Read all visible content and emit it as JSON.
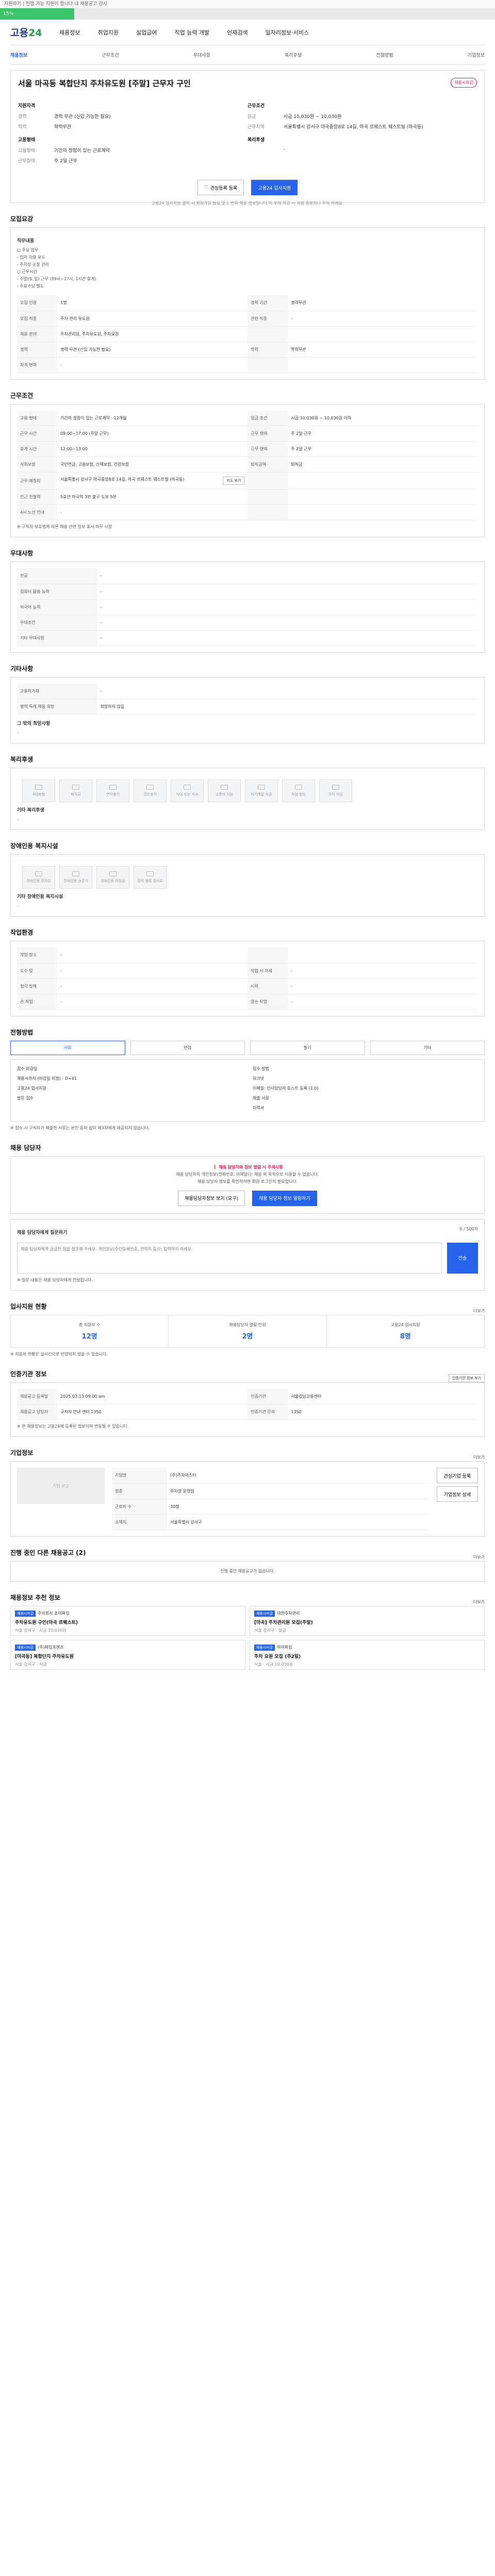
{
  "notice": "지원하기 | 진행 가능 지원이 합니다 내 채용공고 검사",
  "progress": {
    "label": "15%",
    "fraction": 0.15
  },
  "logo": {
    "a": "고용",
    "b": "24"
  },
  "gnb": [
    "채용정보",
    "취업지원",
    "실업급여",
    "직업 능력 개발",
    "인재검색",
    "일자리정보·서비스"
  ],
  "tabs": [
    "채용정보",
    "근무조건",
    "우대사항",
    "복리후생",
    "전형방법",
    "기업정보"
  ],
  "job": {
    "title": "서울 마곡동 복합단지 주차유도원 [주말] 근무자 구인",
    "badge": "채용시마감",
    "left_head": "지원자격",
    "left_rows": [
      [
        "경력",
        "경력 무관 (신입 가능한 필요)"
      ],
      [
        "학력",
        "학력무관"
      ]
    ],
    "right_head": "근무조건",
    "right_rows": [
      [
        "임금",
        "시급 10,030원 ~ 10,030원"
      ],
      [
        "근무지역",
        "서울특별시 강서구 마곡중앙8로 14길, 마곡 르웨스트 웨스트빌 (마곡동)"
      ]
    ],
    "left_head2": "고용형태",
    "left_rows2": [
      [
        "고용형태",
        "기간의 정함이 있는 근로계약"
      ],
      [
        "근무형태",
        "주 2일 근무"
      ]
    ],
    "right_head2": "복리후생",
    "right_rows2": [
      [
        "",
        "-"
      ]
    ],
    "btn_save": "관심등록 등록",
    "btn_apply": "고용24 입사지원",
    "note": "고용24 입사지원 클릭 시 회원가입 필요 및 1 번의 채용 정보입니다 이 후에 마감 시 지원 종료되니 주의 하세요."
  },
  "sec_recruit": {
    "title": "모집요강",
    "subhead": "직무내용",
    "desc1": "○ 주요 업무",
    "desc2": "- 입차 차량 유도",
    "desc3": "- 주차장 순찰 관리",
    "desc4": "○ 근무시간",
    "desc5": "- 주말(토,일) 근무 (09시~17시, 1시간 휴게)",
    "desc6": "- 주휴수당 별도",
    "rows": [
      [
        "모집 인원",
        "1명",
        "경력 기간",
        "경력무관"
      ],
      [
        "모집 직종",
        "주차 관리 유도원",
        "관련 직종",
        "-"
      ],
      [
        "채용 분야",
        "주차관리원, 주차유도원, 주차요원",
        "",
        " "
      ],
      [
        "경력",
        "경력 무관 (신입 가능한 필요)",
        "학력",
        "학력무관"
      ],
      [
        "자격 면허",
        "-",
        "",
        ""
      ]
    ]
  },
  "sec_cond": {
    "title": "근무조건",
    "rows": [
      [
        "고용 형태",
        "기간의 정함이 있는 근로계약 · 12개월",
        "임금 조건",
        "시급 10,030원 ~ 10,030원 이하"
      ],
      [
        "근무 시간",
        "09:00~17:00 (주말 근무)",
        "근무 형태",
        "주 2일 근무"
      ],
      [
        "휴게 시간",
        "12:00~13:00",
        "근무 형태",
        "주 2일 근무"
      ],
      [
        "사회보험",
        "국민연금, 고용보험, 산재보험, 건강보험",
        "퇴직급여",
        "퇴직금"
      ],
      [
        "근무 예정지",
        "서울특별시 강서구 마곡중앙8로 14길, 마곡 르웨스트 웨스트빌 (마곡동)",
        "",
        ""
      ],
      [
        "인근 전철역",
        "5호선 마곡역 3번 출구 도보 5분",
        "",
        ""
      ],
      [
        "4시 노선 안내",
        "-",
        "",
        ""
      ]
    ],
    "map_btn": "지도 보기",
    "footnote": "※ 구직자 보호법에 따른 채용 관련 정보 표시 의무 사항"
  },
  "sec_pref": {
    "title": "우대사항",
    "rows": [
      [
        "전공",
        "-"
      ],
      [
        "컴퓨터 활용 능력",
        "-"
      ],
      [
        "외국어 능력",
        "-"
      ],
      [
        "우대조건",
        "-"
      ],
      [
        "기타 우대사항",
        "-"
      ]
    ]
  },
  "sec_etc": {
    "title": "기타사항",
    "rows": [
      [
        "고용허가제",
        "-"
      ],
      [
        "병역 특례 채용 희망",
        "희망하지 않음"
      ]
    ],
    "extra_head": "그 밖의 희망사항",
    "extra_val": "-"
  },
  "sec_welfare": {
    "title": "복리후생",
    "items": [
      "4대보험",
      "퇴직금",
      "연차휴가",
      "경조휴가",
      "식대 또는 식사",
      "교통비 지원",
      "자기계발 지원",
      "직원 할인",
      "주차 지원"
    ],
    "note_head": "기타 복리후생",
    "note_val": "-"
  },
  "sec_disabled": {
    "title": "장애인용 복지시설",
    "items": [
      "장애인용 주차장",
      "장애인용 승강기",
      "장애인용 화장실",
      "점자 블록 경사로"
    ],
    "note_head": "기타 장애인용 복지시설",
    "note_val": "-"
  },
  "sec_env": {
    "title": "작업환경",
    "rows": [
      [
        "작업 장소",
        "-",
        "",
        ""
      ],
      [
        "도수 및",
        "-",
        "작업 시 자세",
        "-"
      ],
      [
        "청각 장해",
        "-",
        "시력",
        "-"
      ],
      [
        "손 작업",
        "-",
        "양손 작업",
        "-"
      ]
    ]
  },
  "sec_method": {
    "title": "전형방법",
    "opts": [
      "서류",
      "면접",
      "필기",
      "기타"
    ],
    "left": [
      "접수 마감일",
      "채용시까지 (마감일 미정) - D+41",
      "고용24 입사지원",
      "방문 접수"
    ],
    "right": [
      "접수 방법",
      "워크넷",
      "이메일: 인사담당자 호스트 등록 (1.0)",
      "제출 서류",
      "이력서"
    ],
    "note": "※ 접수 시 구직자가 제출한 서류는 본인 동의 없이 제3자에게 제공되지 않습니다."
  },
  "sec_contact": {
    "title": "채용 담당자",
    "warn_title": "채용 담당자와 정보 열람 시 주의사항",
    "warn1": "채용 담당자의 개인정보(전화번호, 이메일)는 채용 외 목적으로 이용할 수 없습니다.",
    "warn2": "채용 담당자 정보를 확인하려면 회원 로그인이 필요합니다.",
    "btn1": "채용담당자정보 보기 (요구)",
    "btn2": "채용 담당자 정보 열람하기",
    "inq_head": "채용 담당자에게 질문하기",
    "inq_count": "0 / 500자",
    "inq_ph": "채용 담당자에게 궁금한 점을 질문해 주세요. 개인정보(주민등록번호, 연락처 등)는 입력하지 마세요.",
    "inq_btn": "전송",
    "inq_note": "※ 질문 내용은 채용 담당자에게 전달됩니다."
  },
  "sec_stats": {
    "title": "입사지원 현황",
    "more": "더보기",
    "items": [
      [
        "총 지원자 수",
        "12명"
      ],
      [
        "채용담당자 열람 인원",
        "2명"
      ],
      [
        "고용24 입사지원",
        "8명"
      ]
    ],
    "note": "※ 지원자 현황은 실시간으로 반영되지 않을 수 있습니다."
  },
  "sec_company_info": {
    "title": "인증기관 정보",
    "btn": "인증기관 정보 보기",
    "rows": [
      [
        "채용공고 등록일",
        "2025.03.13 09:00 am",
        "인증기관",
        "서울강남고용센터"
      ],
      [
        "채용공고 담당자",
        "구직자 안내 센터 1350",
        "인증기관 문의",
        "1350"
      ]
    ],
    "note": "※ 본 채용정보는 고용24에 등록된 정보이며 변동될 수 있습니다."
  },
  "sec_company": {
    "title": "기업정보",
    "more": "더보기",
    "logo": "기업 로고",
    "rows": [
      [
        "기업명",
        "(주)주차마스터"
      ],
      [
        "업종",
        "주차장 운영업"
      ],
      [
        "근로자 수",
        "30명"
      ],
      [
        "소재지",
        "서울특별시 강서구"
      ]
    ],
    "btn1": "관심기업 등록",
    "btn2": "기업정보 상세"
  },
  "sec_recent": {
    "title": "진행 중인 다른 채용공고",
    "more": "더보기",
    "count": "(2)",
    "empty": "진행 중인 채용공고가 없습니다."
  },
  "sec_recommend": {
    "title": "채용정보 추천 정보",
    "more": "더보기",
    "items": [
      {
        "tag": "채용시마감",
        "co": "주식회사 조이파킹",
        "title": "주차유도원 구인(마곡 르웨스트)",
        "meta": "서울 강서구 · 시급 10,030원"
      },
      {
        "tag": "채용시마감",
        "co": "대한주차관리",
        "title": "[마곡] 주차관리원 모집(주말)",
        "meta": "서울 강서구 · 월급"
      },
      {
        "tag": "채용시마감",
        "co": "(주)파킹프렌즈",
        "title": "[마곡동] 복합단지 주차유도원",
        "meta": "서울 강서구 · 시급"
      },
      {
        "tag": "채용시마감",
        "co": "하이파킹",
        "title": "주차 요원 모집 (주2일)",
        "meta": "서울 · 시급 10,030원"
      }
    ]
  }
}
